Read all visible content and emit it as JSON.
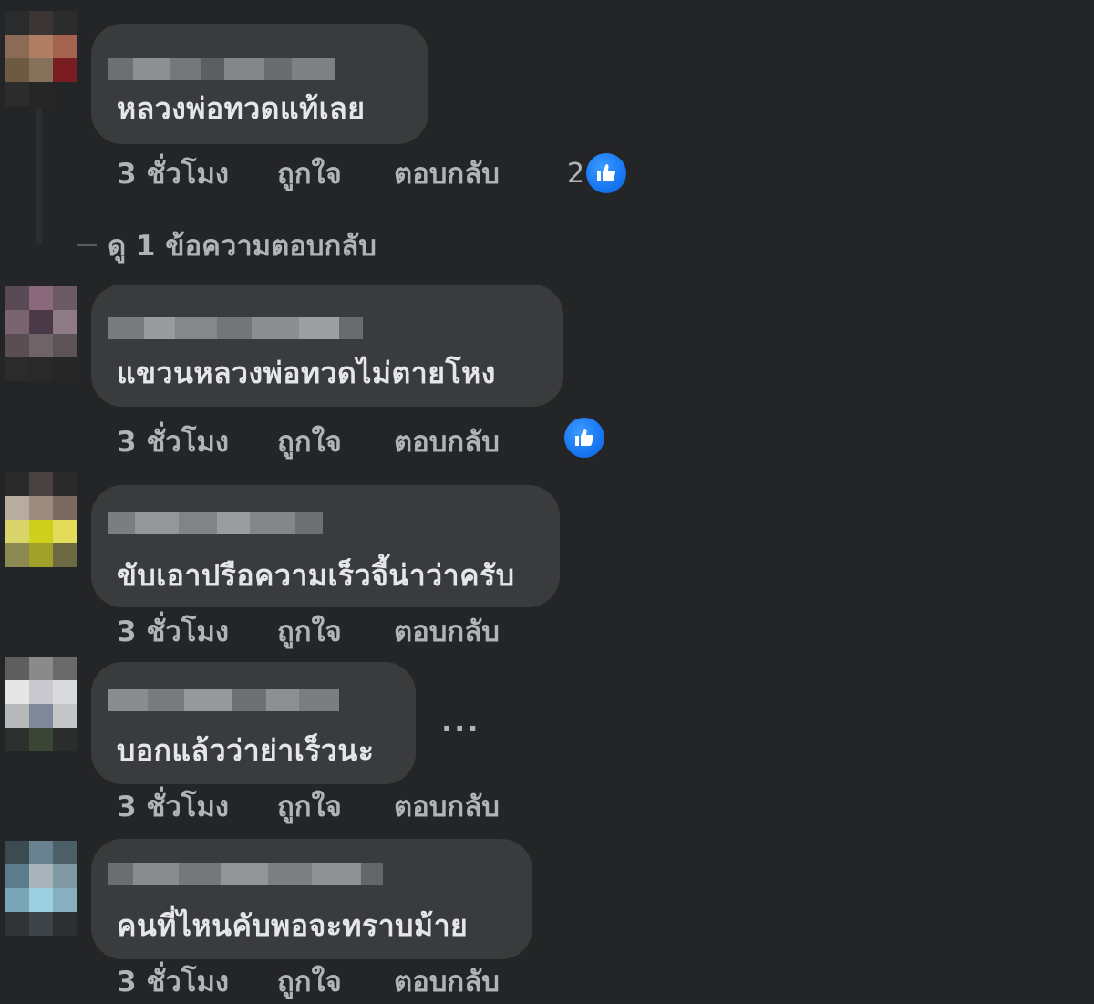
{
  "comments": [
    {
      "text": "หลวงพ่อทวดแท้เลย",
      "time": "3 ชั่วโมง",
      "like_label": "ถูกใจ",
      "reply_label": "ตอบกลับ",
      "reaction_count": "2",
      "view_replies": "ดู 1 ข้อความตอบกลับ"
    },
    {
      "text": "แขวนหลวงพ่อทวดไม่ตายโหง",
      "time": "3 ชั่วโมง",
      "like_label": "ถูกใจ",
      "reply_label": "ตอบกลับ"
    },
    {
      "text": "ขับเอาปรือความเร็วจี้น่าว่าครับ",
      "time": "3 ชั่วโมง",
      "like_label": "ถูกใจ",
      "reply_label": "ตอบกลับ"
    },
    {
      "text": "บอกแล้วว่าย่าเร็วนะ",
      "time": "3 ชั่วโมง",
      "like_label": "ถูกใจ",
      "reply_label": "ตอบกลับ",
      "more_label": "..."
    },
    {
      "text": "คนที่ไหนคับพอจะทราบม้าย",
      "time": "3 ชั่วโมง",
      "like_label": "ถูกใจ",
      "reply_label": "ตอบกลับ"
    }
  ],
  "colors": {
    "background": "#242526",
    "bubble": "#3a3b3c",
    "text": "#e4e6eb",
    "secondary_text": "#b0b3b8",
    "like_blue": "#1877f2"
  },
  "icons": {
    "reaction": "thumbs-up-icon",
    "more": "more-options-icon"
  }
}
